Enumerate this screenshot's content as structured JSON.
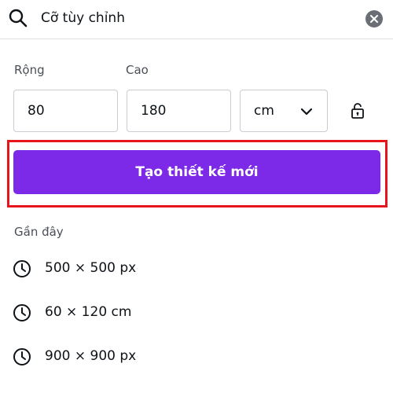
{
  "search": {
    "value": "Cỡ tùy chỉnh",
    "icon": "search-icon",
    "clear_icon": "close-icon"
  },
  "dimensions": {
    "width_label": "Rộng",
    "height_label": "Cao",
    "width_value": "80",
    "height_value": "180",
    "unit": "cm",
    "lock_icon": "unlock-icon"
  },
  "create_button": {
    "label": "Tạo thiết kế mới",
    "color": "#7d2ae8",
    "highlight_color": "#e8141c"
  },
  "recent": {
    "title": "Gần đây",
    "items": [
      {
        "label": "500 × 500 px"
      },
      {
        "label": "60 × 120 cm"
      },
      {
        "label": "900 × 900 px"
      }
    ]
  }
}
